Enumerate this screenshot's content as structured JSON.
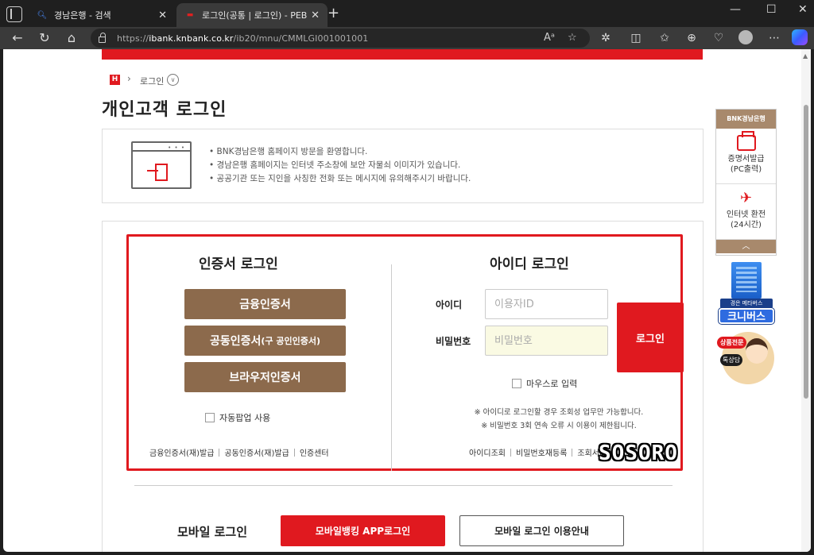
{
  "browser": {
    "tabs": [
      {
        "label": "경남은행 - 검색",
        "favicon": "search-icon",
        "active": false
      },
      {
        "label": "로그인(공통 | 로그인) - PEB0301",
        "favicon": "bnk-favicon",
        "active": true
      }
    ],
    "url_prefix": "https://",
    "url_host": "ibank.knbank.co.kr",
    "url_path": "/ib20/mnu/CMMLGI001001001"
  },
  "breadcrumb": {
    "home": "H",
    "current": "로그인"
  },
  "page_title": "개인고객 로그인",
  "notice": [
    "BNK경남은행 홈페이지 방문을 환영합니다.",
    "경남은행 홈페이지는 인터넷 주소창에 보안 자물쇠 이미지가 있습니다.",
    "공공기관 또는 지인을 사칭한 전화 또는 메시지에 유의해주시기 바랍니다."
  ],
  "cert_login": {
    "title": "인증서 로그인",
    "buttons": {
      "financial": "금융인증서",
      "joint": "공동인증서",
      "joint_sub": "(구 공인인증서)",
      "browser": "브라우저인증서"
    },
    "auto_popup": "자동팝업 사용",
    "links": [
      "금융인증서(재)발급",
      "공동인증서(재)발급",
      "인증센터"
    ]
  },
  "id_login": {
    "title": "아이디 로그인",
    "id_label": "아이디",
    "id_placeholder": "이용자ID",
    "pw_label": "비밀번호",
    "pw_placeholder": "비밀번호",
    "login_button": "로그인",
    "mouse_input": "마우스로 입력",
    "notes": [
      "※ 아이디로 로그인할 경우 조회성 업무만 가능합니다.",
      "※ 비밀번호 3회 연속 오류 시 이용이 제한됩니다."
    ],
    "links": [
      "아이디조회",
      "비밀번호재등록",
      "조회서비스"
    ]
  },
  "mobile": {
    "title": "모바일 로그인",
    "app_button": "모바일뱅킹 APP로그인",
    "guide_button": "모바일 로그인 이용안내"
  },
  "quick_menu": {
    "header": "BNK경남은행",
    "items": [
      {
        "line1": "증명서발급",
        "line2": "(PC출력)",
        "icon": "printer-icon"
      },
      {
        "line1": "인터넷 환전",
        "line2": "(24시간)",
        "icon": "airplane-icon"
      }
    ],
    "up": "︿"
  },
  "promo": {
    "metabus_caption": "경은 메타버스",
    "metabus_logo": "크니버스",
    "consult_tag": "상품전문",
    "consult_badge": "톡상담"
  },
  "watermark": "SOSORO",
  "colors": {
    "brand_red": "#e0191f",
    "brown": "#8c6a4c",
    "quick_brown": "#a8896c"
  }
}
